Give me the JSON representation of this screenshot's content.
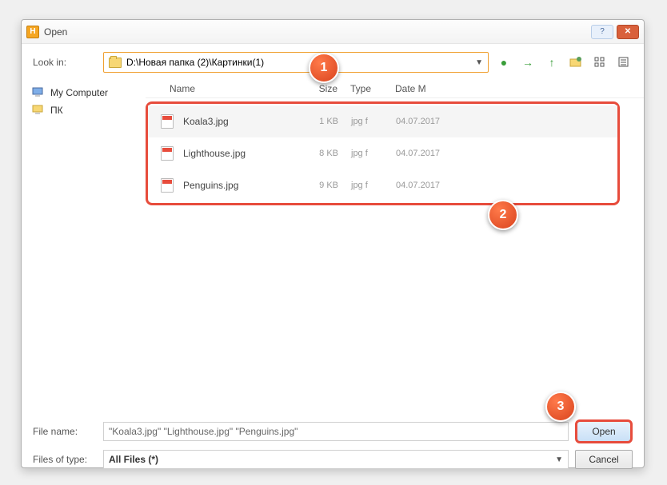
{
  "window": {
    "title": "Open",
    "appicon_letter": "H"
  },
  "toolbar": {
    "lookin_label": "Look in:",
    "path": "D:\\Новая папка (2)\\Картинки(1)"
  },
  "sidebar": {
    "items": [
      {
        "label": "My Computer"
      },
      {
        "label": "ПК"
      }
    ]
  },
  "columns": {
    "name": "Name",
    "size": "Size",
    "type": "Type",
    "date": "Date M"
  },
  "files": [
    {
      "name": "Koala3.jpg",
      "size": "1 KB",
      "type": "jpg f",
      "date": "04.07.2017",
      "selected": true
    },
    {
      "name": "Lighthouse.jpg",
      "size": "8 KB",
      "type": "jpg f",
      "date": "04.07.2017",
      "selected": false
    },
    {
      "name": "Penguins.jpg",
      "size": "9 KB",
      "type": "jpg f",
      "date": "04.07.2017",
      "selected": false
    }
  ],
  "bottom": {
    "filename_label": "File name:",
    "filename_value": "\"Koala3.jpg\" \"Lighthouse.jpg\" \"Penguins.jpg\"",
    "filetype_label": "Files of type:",
    "filetype_value": "All Files (*)",
    "open_label": "Open",
    "cancel_label": "Cancel"
  },
  "callouts": [
    "1",
    "2",
    "3"
  ]
}
